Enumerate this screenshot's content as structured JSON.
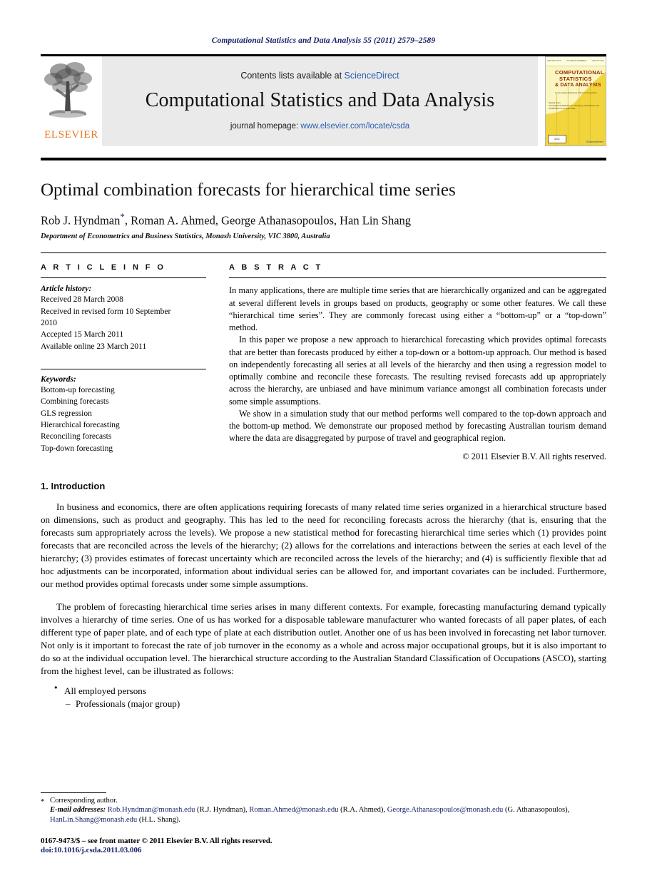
{
  "running_head": "Computational Statistics and Data Analysis 55 (2011) 2579–2589",
  "masthead": {
    "publisher_name": "ELSEVIER",
    "contents_prefix": "Contents lists available at ",
    "contents_link": "ScienceDirect",
    "journal_title": "Computational Statistics and Data Analysis",
    "homepage_prefix": "journal homepage: ",
    "homepage_link": "www.elsevier.com/locate/csda",
    "cover": {
      "top_left": "ISSN 0167-9473",
      "top_center": "VOLUME 55 NUMBER 8",
      "top_right": "AUGUST 2011",
      "title_line1": "COMPUTATIONAL",
      "title_line2": "STATISTICS",
      "title_line3": "& DATA ANALYSIS",
      "subtitle": "incorporating  Statistical Software Newsletter",
      "special_label": "Special Issue:",
      "special_text": "Computational Statistics for Clustering, Classification and Visualization of Complex Data",
      "badge": "IASC",
      "science_direct": "ScienceDirect",
      "footer_note": "The Official Journal of the International Association for Statistical Computing",
      "url_note": "Available online at www.sciencedirect.com"
    }
  },
  "article": {
    "title": "Optimal combination forecasts for hierarchical time series",
    "authors": "Rob J. Hyndman",
    "authors_rest": ", Roman A. Ahmed, George Athanasopoulos, Han Lin Shang",
    "corresponding_marker": "*",
    "affiliation": "Department of Econometrics and Business Statistics, Monash University, VIC 3800, Australia"
  },
  "article_info": {
    "heading": "A R T I C L E     I N F O",
    "history_label": "Article history:",
    "history": [
      "Received 28 March 2008",
      "Received in revised form 10 September",
      "2010",
      "Accepted 15 March 2011",
      "Available online 23 March 2011"
    ],
    "keywords_label": "Keywords:",
    "keywords": [
      "Bottom-up forecasting",
      "Combining forecasts",
      "GLS regression",
      "Hierarchical forecasting",
      "Reconciling forecasts",
      "Top-down forecasting"
    ]
  },
  "abstract": {
    "heading": "A B S T R A C T",
    "paragraphs": [
      "In many applications, there are multiple time series that are hierarchically organized and can be aggregated at several different levels in groups based on products, geography or some other features. We call these “hierarchical time series”. They are commonly forecast using either a “bottom-up” or a “top-down” method.",
      "In this paper we propose a new approach to hierarchical forecasting which provides optimal forecasts that are better than forecasts produced by either a top-down or a bottom-up approach. Our method is based on independently forecasting all series at all levels of the hierarchy and then using a regression model to optimally combine and reconcile these forecasts. The resulting revised forecasts add up appropriately across the hierarchy, are unbiased and have minimum variance amongst all combination forecasts under some simple assumptions.",
      "We show in a simulation study that our method performs well compared to the top-down approach and the bottom-up method. We demonstrate our proposed method by forecasting Australian tourism demand where the data are disaggregated by purpose of travel and geographical region."
    ],
    "copyright": "© 2011 Elsevier B.V. All rights reserved."
  },
  "body": {
    "section_number_title": "1. Introduction",
    "paragraphs": [
      "In business and economics, there are often applications requiring forecasts of many related time series organized in a hierarchical structure based on dimensions, such as product and geography. This has led to the need for reconciling forecasts across the hierarchy (that is, ensuring that the forecasts sum appropriately across the levels). We propose a new statistical method for forecasting hierarchical time series which (1) provides point forecasts that are reconciled across the levels of the hierarchy; (2) allows for the correlations and interactions between the series at each level of the hierarchy; (3) provides estimates of forecast uncertainty which are reconciled across the levels of the hierarchy; and (4) is sufficiently flexible that ad hoc adjustments can be incorporated, information about individual series can be allowed for, and important covariates can be included. Furthermore, our method provides optimal forecasts under some simple assumptions.",
      "The problem of forecasting hierarchical time series arises in many different contexts. For example, forecasting manufacturing demand typically involves a hierarchy of time series. One of us has worked for a disposable tableware manufacturer who wanted forecasts of all paper plates, of each different type of paper plate, and of each type of plate at each distribution outlet. Another one of us has been involved in forecasting net labor turnover. Not only is it important to forecast the rate of job turnover in the economy as a whole and across major occupational groups, but it is also important to do so at the individual occupation level. The hierarchical structure according to the Australian Standard Classification of Occupations (ASCO), starting from the highest level, can be illustrated as follows:"
    ],
    "bullets": [
      {
        "level": 1,
        "text": "All employed persons"
      },
      {
        "level": 2,
        "text": "Professionals (major group)"
      }
    ]
  },
  "footnotes": {
    "corresponding": "Corresponding author.",
    "corresponding_marker": "*",
    "emails_label": "E-mail addresses:",
    "emails": [
      {
        "address": "Rob.Hyndman@monash.edu",
        "name": "(R.J. Hyndman)"
      },
      {
        "address": "Roman.Ahmed@monash.edu",
        "name": "(R.A. Ahmed)"
      },
      {
        "address": "George.Athanasopoulos@monash.edu",
        "name": "(G. Athanasopoulos)"
      },
      {
        "address": "HanLin.Shang@monash.edu",
        "name": "(H.L. Shang)"
      }
    ],
    "issn_line": "0167-9473/$ – see front matter © 2011 Elsevier B.V. All rights reserved.",
    "doi_line": "doi:10.1016/j.csda.2011.03.006"
  },
  "colors": {
    "link_blue": "#2b5eb0",
    "dark_navy": "#17226b",
    "elsevier_orange": "#e87722",
    "band_gray": "#eaeaea"
  }
}
